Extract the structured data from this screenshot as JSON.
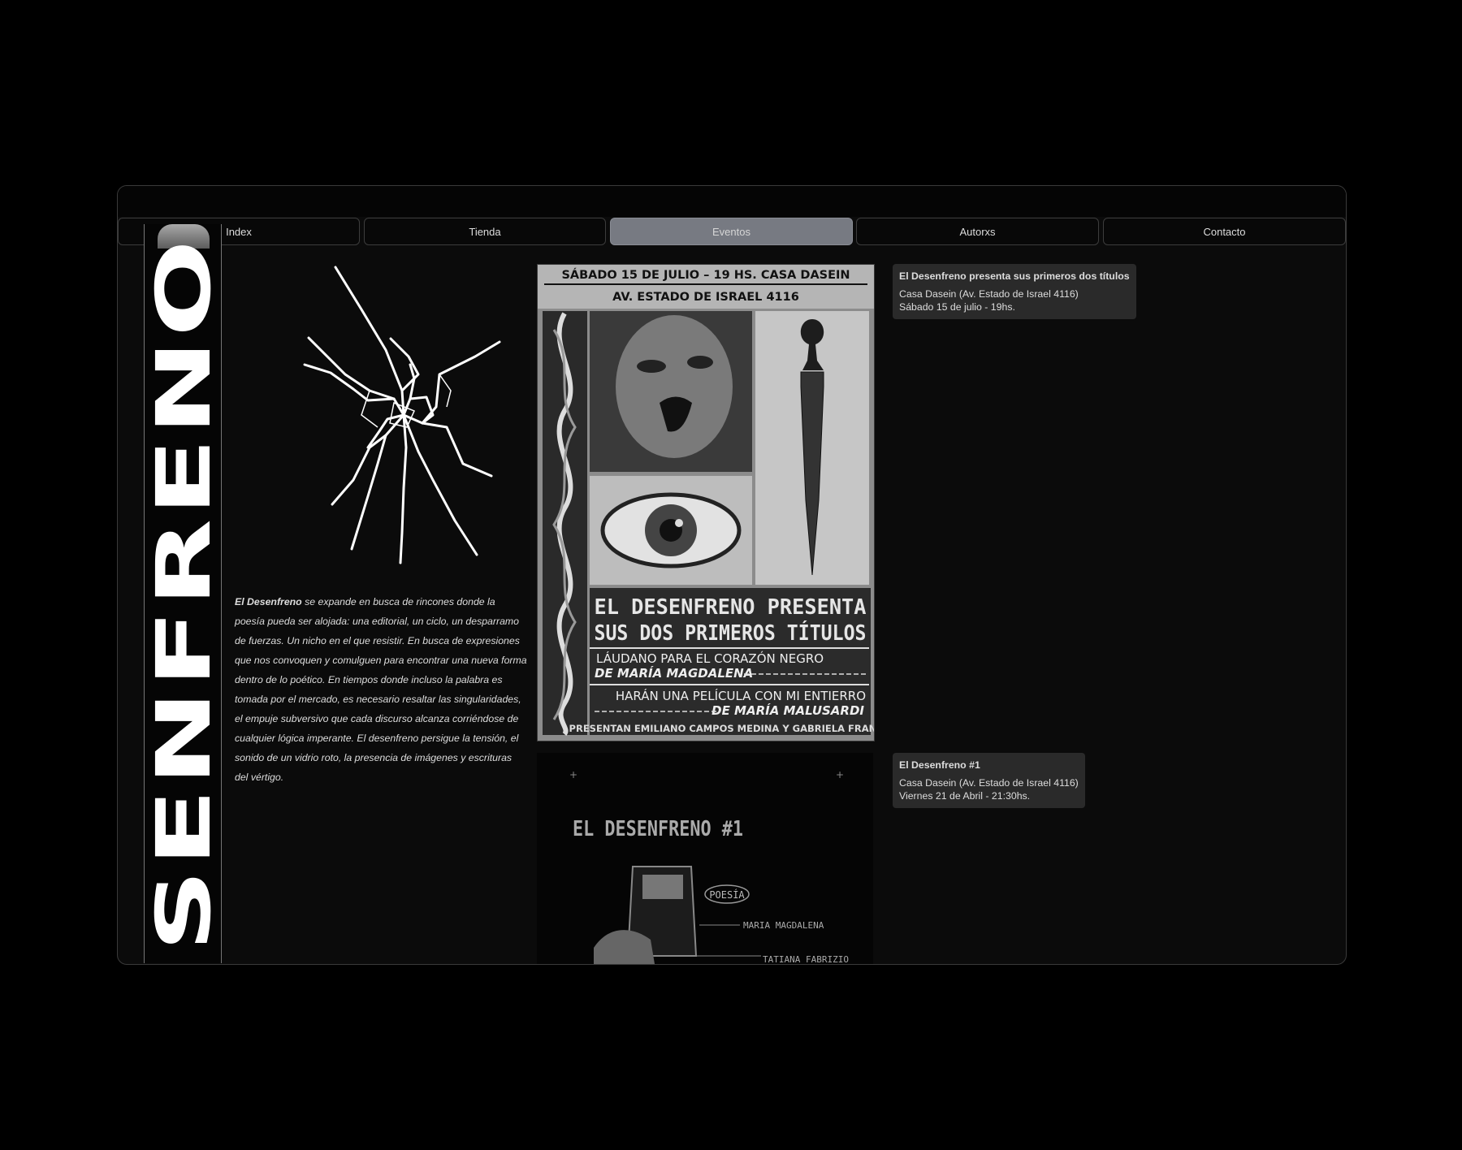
{
  "nav": {
    "tabs": [
      {
        "label": "Index"
      },
      {
        "label": "Tienda"
      },
      {
        "label": "Eventos"
      },
      {
        "label": "Autorxs"
      },
      {
        "label": "Contacto"
      }
    ],
    "active": "Eventos"
  },
  "logo": {
    "text": "SENFRENO"
  },
  "description": {
    "brand": "El Desenfreno",
    "text": " se expande en busca de rincones donde la poesía pueda ser alojada: una editorial, un ciclo, un desparramo de fuerzas. Un nicho en el que resistir. En busca de expresiones que nos convoquen y comulguen para encontrar una nueva forma dentro de lo poético. En tiempos donde incluso la palabra es tomada por el mercado, es necesario resaltar las singularidades, el empuje subversivo que cada discurso alcanza corriéndose de cualquier lógica imperante. El desenfreno persigue la tensión, el sonido de un vidrio roto, la presencia de imágenes y escrituras del vértigo."
  },
  "poster1": {
    "header1": "SÁBADO 15 DE JULIO – 19 HS. CASA DASEIN",
    "header2": "AV. ESTADO DE ISRAEL 4116",
    "title1": "EL DESENFRENO PRESENTA",
    "title2": "SUS DOS PRIMEROS TÍTULOS",
    "book1": "LÁUDANO PARA EL CORAZÓN NEGRO",
    "author1": "DE MARÍA MAGDALENA",
    "book2": "HARÁN UNA PELÍCULA CON MI ENTIERRO",
    "author2": "DE MARÍA MALUSARDI",
    "footer": "PRESENTAN EMILIANO CAMPOS MEDINA Y GABRIELA FRANCO"
  },
  "poster2": {
    "title": "EL DESENFRENO #1",
    "tag": "POESÍA",
    "name1": "MARIA MAGDALENA",
    "name2": "TATIANA FABRIZIO"
  },
  "events": [
    {
      "title": "El Desenfreno presenta sus primeros dos títulos",
      "place": "Casa Dasein (Av. Estado de Israel 4116)",
      "date": "Sábado 15 de julio - 19hs."
    },
    {
      "title": "El Desenfreno #1",
      "place": "Casa Dasein (Av. Estado de Israel 4116)",
      "date": "Viernes 21 de Abril - 21:30hs."
    }
  ],
  "colors": {
    "background": "#000000",
    "window": "#0b0b0b",
    "active_tab": "#777a82",
    "card": "#2a2a2a"
  }
}
